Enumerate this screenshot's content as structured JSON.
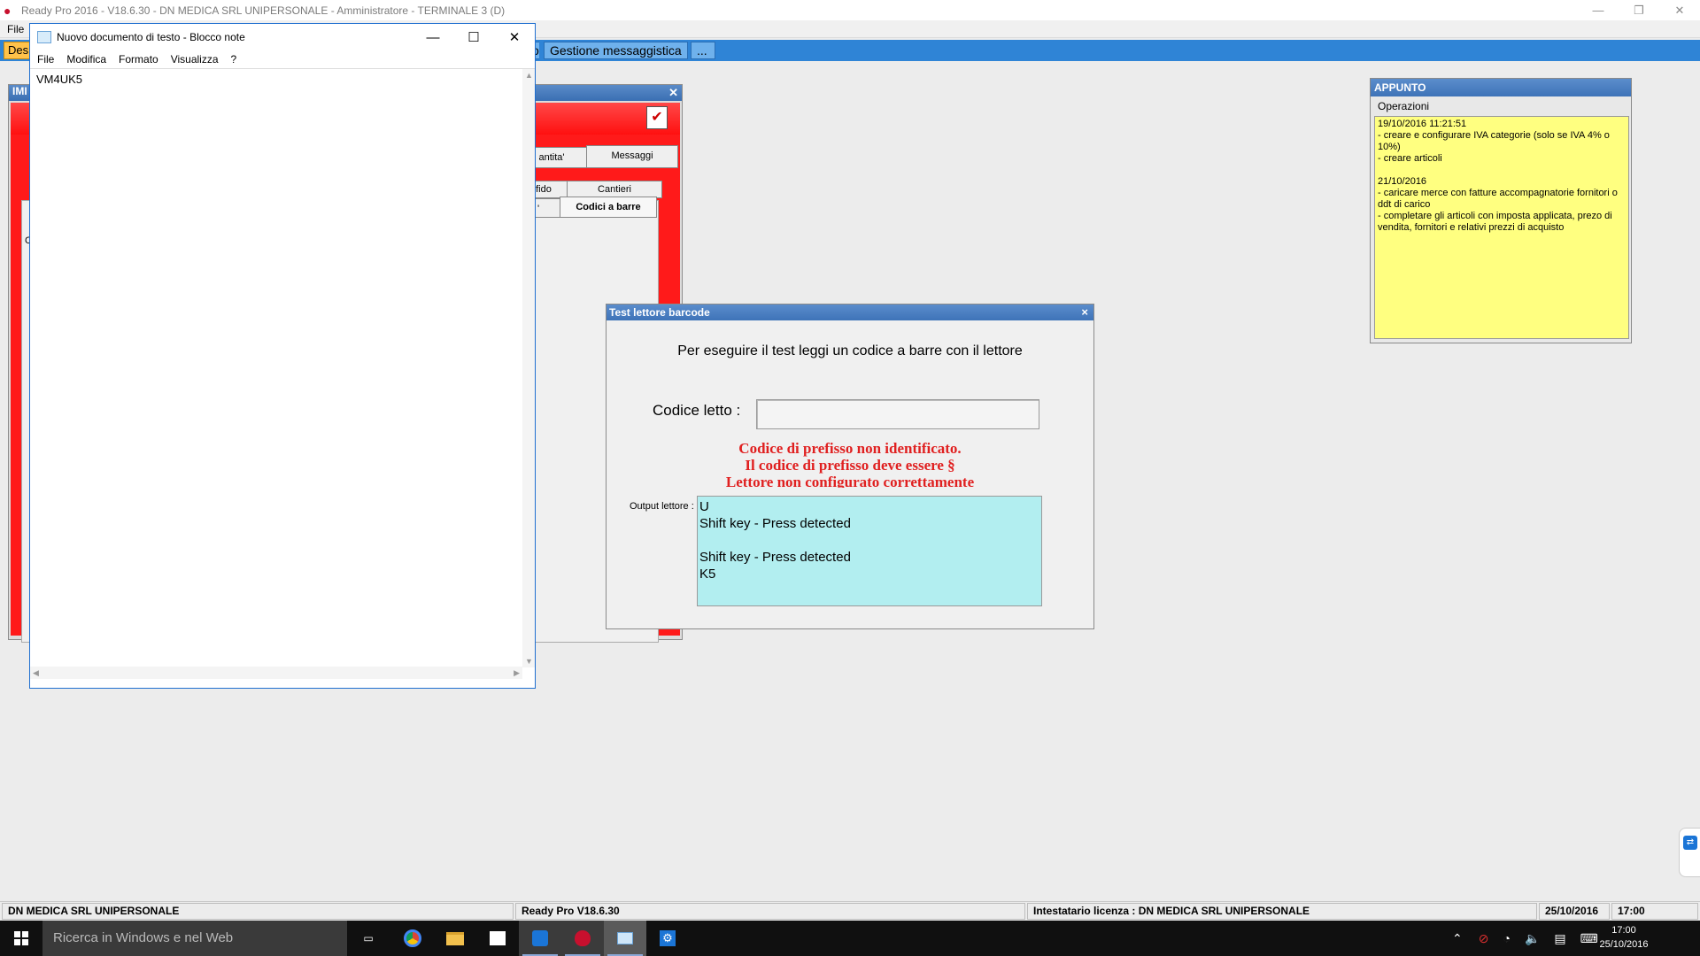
{
  "app": {
    "title": "Ready Pro 2016 - V18.6.30 - DN MEDICA SRL UNIPERSONALE - Amministratore - TERMINALE 3 (D)",
    "menu_file": "File",
    "window_buttons": {
      "minimize": "—",
      "restore": "❐",
      "close": "✕"
    }
  },
  "tabs": {
    "first": "Des",
    "messaggistica": "Gestione messaggistica",
    "more": "...",
    "hidden_tab_prefix": "o"
  },
  "background_window": {
    "title": "IMI",
    "tab_quantita": "antita'",
    "tab_messaggi": "Messaggi",
    "tab_fido": "fido",
    "tab_cantieri": "Cantieri",
    "tab_prev": "'",
    "tab_codici": "Codici a barre",
    "side_letter": "C"
  },
  "notepad": {
    "title": "Nuovo documento di testo - Blocco note",
    "menu": [
      "File",
      "Modifica",
      "Formato",
      "Visualizza",
      "?"
    ],
    "content": "VM4UK5"
  },
  "barcode_dialog": {
    "title": "Test lettore barcode",
    "close": "×",
    "instruction": "Per eseguire il test leggi un codice a barre con il lettore",
    "code_label": "Codice letto :",
    "code_value": "",
    "error_line1": "Codice di prefisso non identificato.",
    "error_line2": "Il codice di prefisso deve essere §",
    "error_line3": "Lettore non configurato correttamente",
    "output_label": "Output lettore :",
    "output_text": "U\nShift key - Press detected\n\nShift key - Press detected\nK5"
  },
  "appunto": {
    "title": "APPUNTO",
    "operations": "Operazioni",
    "note": "19/10/2016 11:21:51\n- creare e configurare IVA categorie (solo se IVA 4% o 10%)\n- creare articoli\n\n21/10/2016\n- caricare merce con fatture accompagnatorie fornitori o ddt di carico\n- completare gli articoli con imposta applicata, prezo di vendita, fornitori e relativi prezzi di acquisto"
  },
  "statusbar": {
    "company": "DN MEDICA SRL UNIPERSONALE",
    "version": "Ready Pro V18.6.30",
    "license": "Intestatario licenza : DN MEDICA SRL UNIPERSONALE",
    "date": "25/10/2016",
    "time": "17:00"
  },
  "taskbar": {
    "search_placeholder": "Ricerca in Windows e nel Web",
    "clock_time": "17:00",
    "clock_date": "25/10/2016"
  }
}
